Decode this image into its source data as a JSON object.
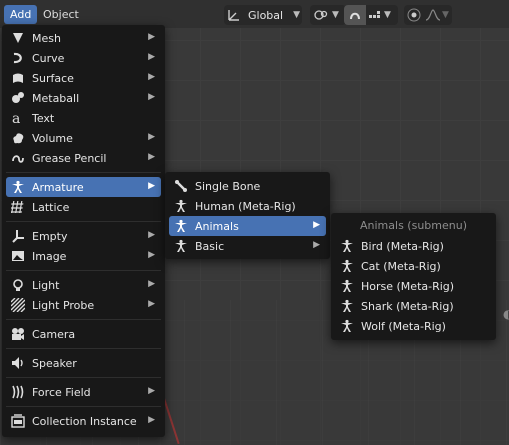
{
  "header": {
    "add_label": "Add",
    "object_label": "Object",
    "orientation": "Global"
  },
  "menu": {
    "items": [
      {
        "label": "Mesh",
        "icon": "mesh-icon",
        "submenu": true
      },
      {
        "label": "Curve",
        "icon": "curve-icon",
        "submenu": true
      },
      {
        "label": "Surface",
        "icon": "surface-icon",
        "submenu": true
      },
      {
        "label": "Metaball",
        "icon": "metaball-icon",
        "submenu": true
      },
      {
        "label": "Text",
        "icon": "text-icon",
        "submenu": false
      },
      {
        "label": "Volume",
        "icon": "volume-icon",
        "submenu": true
      },
      {
        "label": "Grease Pencil",
        "icon": "grease-pencil-icon",
        "submenu": true
      },
      {
        "label": "Armature",
        "icon": "armature-icon",
        "submenu": true,
        "highlighted": true
      },
      {
        "label": "Lattice",
        "icon": "lattice-icon",
        "submenu": false
      },
      {
        "label": "Empty",
        "icon": "empty-icon",
        "submenu": true
      },
      {
        "label": "Image",
        "icon": "image-icon",
        "submenu": true
      },
      {
        "label": "Light",
        "icon": "light-icon",
        "submenu": true
      },
      {
        "label": "Light Probe",
        "icon": "light-probe-icon",
        "submenu": true
      },
      {
        "label": "Camera",
        "icon": "camera-icon",
        "submenu": false
      },
      {
        "label": "Speaker",
        "icon": "speaker-icon",
        "submenu": false
      },
      {
        "label": "Force Field",
        "icon": "force-field-icon",
        "submenu": true
      },
      {
        "label": "Collection Instance",
        "icon": "collection-instance-icon",
        "submenu": true
      }
    ]
  },
  "armature_menu": {
    "items": [
      {
        "label": "Single Bone",
        "icon": "bone-icon",
        "submenu": false
      },
      {
        "label": "Human (Meta-Rig)",
        "icon": "armature-icon",
        "submenu": false
      },
      {
        "label": "Animals",
        "icon": "armature-icon",
        "submenu": true,
        "highlighted": true
      },
      {
        "label": "Basic",
        "icon": "armature-icon",
        "submenu": true
      }
    ]
  },
  "animals_menu": {
    "title": "Animals (submenu)",
    "items": [
      {
        "label": "Bird (Meta-Rig)",
        "icon": "armature-icon"
      },
      {
        "label": "Cat (Meta-Rig)",
        "icon": "armature-icon"
      },
      {
        "label": "Horse (Meta-Rig)",
        "icon": "armature-icon"
      },
      {
        "label": "Shark (Meta-Rig)",
        "icon": "armature-icon"
      },
      {
        "label": "Wolf (Meta-Rig)",
        "icon": "armature-icon"
      }
    ]
  },
  "colors": {
    "highlight": "#4772b3",
    "menu_bg": "#181818",
    "header_bg": "#303030"
  }
}
